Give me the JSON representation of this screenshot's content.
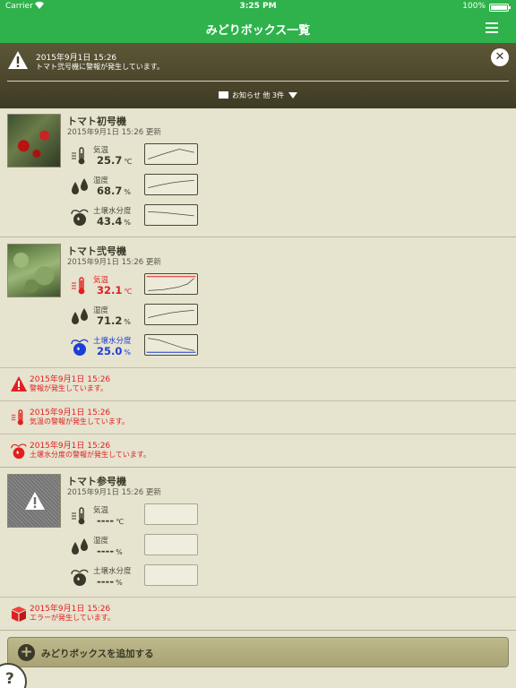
{
  "status_bar": {
    "carrier": "Carrier",
    "time": "3:25 PM",
    "battery": "100%"
  },
  "nav": {
    "title": "みどりボックス一覧"
  },
  "notice": {
    "date": "2015年9月1日 15:26",
    "message": "トマト弐号機に警報が発生しています。",
    "more": "お知らせ 他 3件"
  },
  "boxes": [
    {
      "name": "トマト初号機",
      "updated": "2015年9月1日 15:26 更新",
      "sensors": [
        {
          "label": "気温",
          "value": "25.7",
          "unit": "℃",
          "state": "normal"
        },
        {
          "label": "湿度",
          "value": "68.7",
          "unit": "%",
          "state": "normal"
        },
        {
          "label": "土壌水分度",
          "value": "43.4",
          "unit": "%",
          "state": "normal"
        }
      ]
    },
    {
      "name": "トマト弐号機",
      "updated": "2015年9月1日 15:26 更新",
      "sensors": [
        {
          "label": "気温",
          "value": "32.1",
          "unit": "℃",
          "state": "alert-high"
        },
        {
          "label": "湿度",
          "value": "71.2",
          "unit": "%",
          "state": "normal"
        },
        {
          "label": "土壌水分度",
          "value": "25.0",
          "unit": "%",
          "state": "alert-low"
        }
      ],
      "alerts": [
        {
          "icon": "warning-icon",
          "date": "2015年9月1日 15:26",
          "message": "警報が発生しています。"
        },
        {
          "icon": "thermometer-icon",
          "date": "2015年9月1日 15:26",
          "message": "気温の警報が発生しています。"
        },
        {
          "icon": "soil-icon",
          "date": "2015年9月1日 15:26",
          "message": "土壌水分度の警報が発生しています。"
        }
      ]
    },
    {
      "name": "トマト参号機",
      "updated": "2015年9月1日 15:26 更新",
      "sensors": [
        {
          "label": "気温",
          "value": "----",
          "unit": "℃",
          "state": "none"
        },
        {
          "label": "湿度",
          "value": "----",
          "unit": "%",
          "state": "none"
        },
        {
          "label": "土壌水分度",
          "value": "----",
          "unit": "%",
          "state": "none"
        }
      ],
      "alerts": [
        {
          "icon": "error-box-icon",
          "date": "2015年9月1日 15:26",
          "message": "エラーが発生しています。"
        }
      ]
    }
  ],
  "add_button": {
    "label": "みどりボックスを追加する"
  },
  "help": {
    "label": "?"
  },
  "colors": {
    "nav": "#2fb24c",
    "background": "#e6e3cf",
    "alert": "#e02020",
    "low": "#1a3fd6"
  }
}
